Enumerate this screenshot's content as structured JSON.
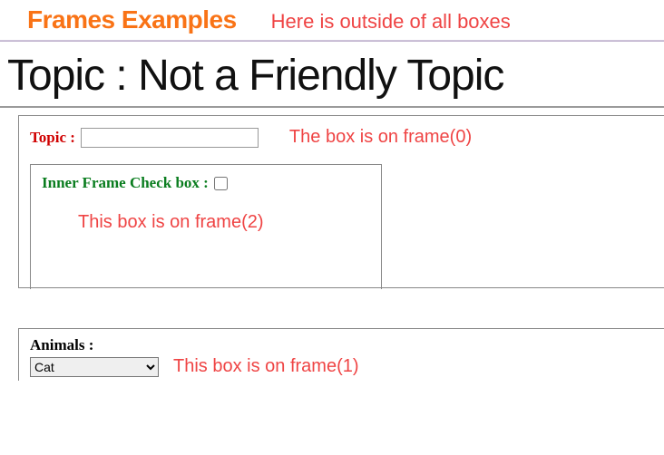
{
  "header": {
    "frames_title": "Frames Examples",
    "outside_note": "Here is outside of all boxes"
  },
  "main_heading": "Topic : Not a Friendly Topic",
  "frame0": {
    "topic_label": "Topic :",
    "topic_value": "",
    "note": "The box is on frame(0)"
  },
  "frame2": {
    "inner_label": "Inner Frame Check box :",
    "note": "This box is on frame(2)"
  },
  "frame1": {
    "animals_label": "Animals :",
    "selected": "Cat",
    "note": "This box is on frame(1)"
  }
}
